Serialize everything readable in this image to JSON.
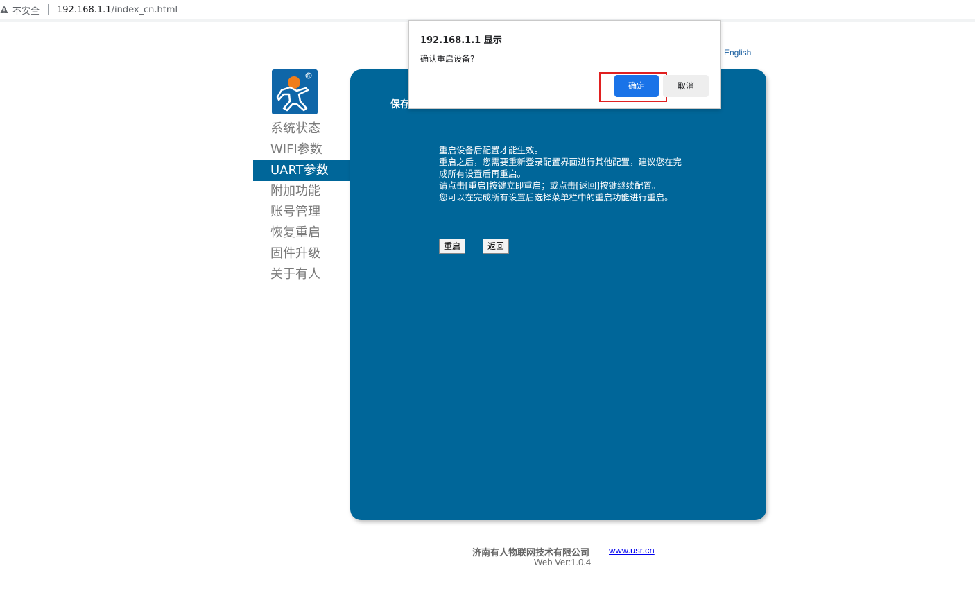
{
  "browser": {
    "insecure_label": "不安全",
    "url_host": "192.168.1.1",
    "url_path": "/index_cn.html"
  },
  "lang_link": "English",
  "sidebar": {
    "items": [
      {
        "label": "系统状态",
        "active": false
      },
      {
        "label": "WIFI参数",
        "active": false
      },
      {
        "label": "UART参数",
        "active": true
      },
      {
        "label": "附加功能",
        "active": false
      },
      {
        "label": "账号管理",
        "active": false
      },
      {
        "label": "恢复重启",
        "active": false
      },
      {
        "label": "固件升级",
        "active": false
      },
      {
        "label": "关于有人",
        "active": false
      }
    ]
  },
  "panel": {
    "title": "保存",
    "message_lines": [
      "重启设备后配置才能生效。",
      "重启之后，您需要重新登录配置界面进行其他配置，建议您在完",
      "成所有设置后再重启。",
      "请点击[重启]按键立即重启；或点击[返回]按键继续配置。",
      "您可以在完成所有设置后选择菜单栏中的重启功能进行重启。"
    ],
    "restart_button": "重启",
    "back_button": "返回",
    "bg_color": "#006699"
  },
  "footer": {
    "company": "济南有人物联网技术有限公司",
    "link": "www.usr.cn",
    "version": "Web Ver:1.0.4"
  },
  "dialog": {
    "title": "192.168.1.1 显示",
    "message": "确认重启设备?",
    "ok_label": "确定",
    "cancel_label": "取消",
    "ok_color": "#1a73e8",
    "highlight_color": "#e02020"
  }
}
